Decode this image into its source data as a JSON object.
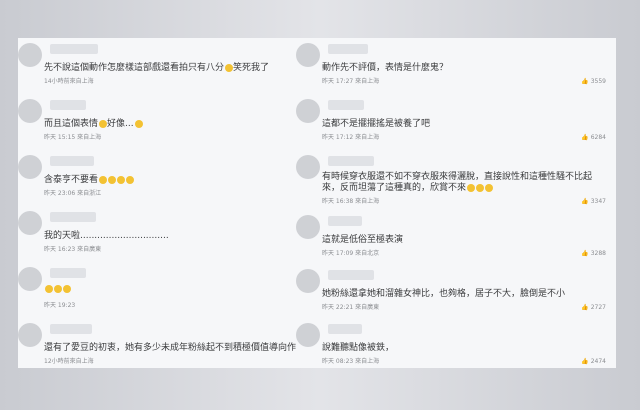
{
  "left": [
    {
      "text": "先不說這個動作怎麼樣這部戲還看拍只有八分",
      "emoji_after": "笑死我了",
      "meta": "14小時前來自上海"
    },
    {
      "text": "而且這個表情",
      "emoji_after": "好像...",
      "meta": "昨天 15:15 來自上海"
    },
    {
      "text": "含泰亨不要看",
      "emoji_after": "",
      "meta": "昨天 23:06 來自浙江"
    },
    {
      "text": "我的天啦...............................",
      "emoji_after": "",
      "meta": "昨天 16:23 來自廣東"
    },
    {
      "text": "",
      "emoji_after": "",
      "meta": "昨天 19:23"
    },
    {
      "text": "還有了愛豆的初衷，她有多少未成年粉絲起不到積極價值導向作用",
      "emoji_after": "",
      "meta": "12小時前來自上海"
    }
  ],
  "right": [
    {
      "text": "動作先不評價，表情是什麼鬼？",
      "meta": "昨天 17:27 來自上海",
      "likes": "3559"
    },
    {
      "text": "這都不是擺擺搖是被養了吧",
      "meta": "昨天 17:12 來自上海",
      "likes": "6284"
    },
    {
      "text": "有時候穿衣服還不如不穿衣服來得灑脫，直接說性和這種性騷不比起來，反而坦蕩了這種真的，欣賞不來",
      "meta": "昨天 16:38 來自上海",
      "likes": "3347"
    },
    {
      "text": "這就是低俗至極表演",
      "meta": "昨天 17:09 來自北京",
      "likes": "3288"
    },
    {
      "text": "她粉絲還拿她和溜雜女神比，也夠格，居子不大，臉倒是不小",
      "meta": "昨天 22:21 來自廣東",
      "likes": "2727"
    },
    {
      "text": "說難聽點像被鉄，",
      "meta": "昨天 08:23 來自上海",
      "likes": "2474"
    }
  ]
}
